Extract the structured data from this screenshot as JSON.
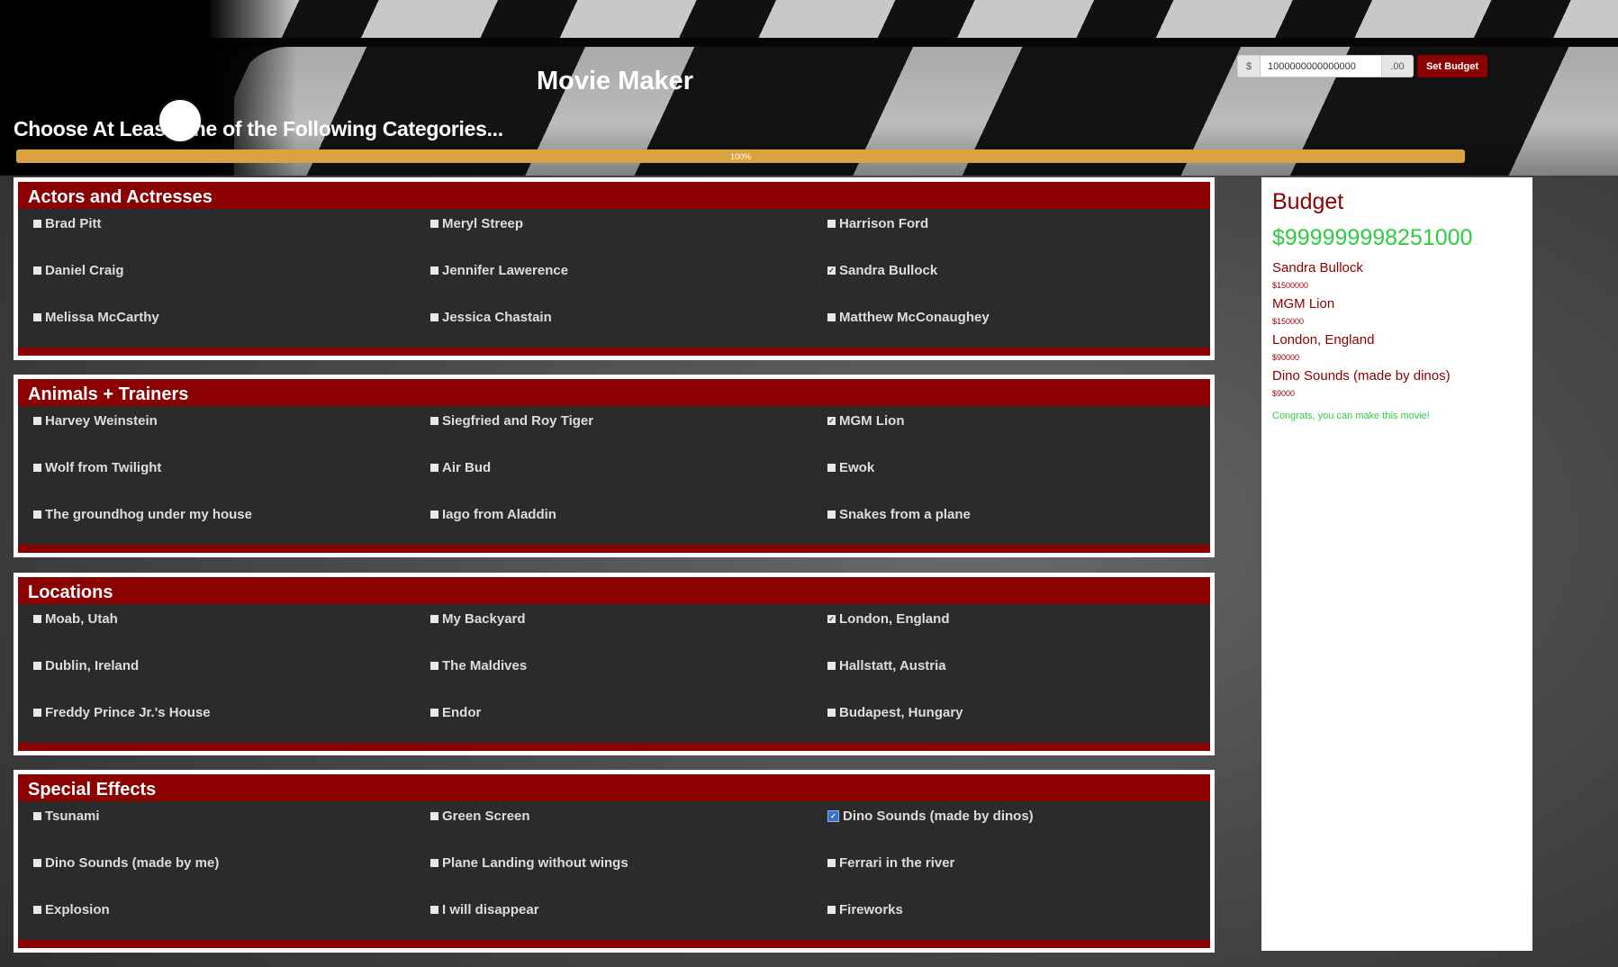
{
  "app": {
    "title": "Movie Maker",
    "subtitle": "Choose At Least One of the Following Categories..."
  },
  "budget_form": {
    "currency": "$",
    "value": "1000000000000000",
    "cents": ".00",
    "button": "Set Budget"
  },
  "progress": {
    "percent": 100,
    "label": "100%",
    "color": "#d9a440"
  },
  "colors": {
    "accent": "#8b0000",
    "success": "#2ecc40",
    "panel": "#2b2b2b"
  },
  "categories": [
    {
      "title": "Actors and Actresses",
      "options": [
        {
          "label": "Brad Pitt",
          "checked": false
        },
        {
          "label": "Meryl Streep",
          "checked": false
        },
        {
          "label": "Harrison Ford",
          "checked": false
        },
        {
          "label": "Daniel Craig",
          "checked": false
        },
        {
          "label": "Jennifer Lawerence",
          "checked": false
        },
        {
          "label": "Sandra Bullock",
          "checked": true
        },
        {
          "label": "Melissa McCarthy",
          "checked": false
        },
        {
          "label": "Jessica Chastain",
          "checked": false
        },
        {
          "label": "Matthew McConaughey",
          "checked": false
        }
      ]
    },
    {
      "title": "Animals + Trainers",
      "options": [
        {
          "label": "Harvey Weinstein",
          "checked": false
        },
        {
          "label": "Siegfried and Roy Tiger",
          "checked": false
        },
        {
          "label": "MGM Lion",
          "checked": true
        },
        {
          "label": "Wolf from Twilight",
          "checked": false
        },
        {
          "label": "Air Bud",
          "checked": false
        },
        {
          "label": "Ewok",
          "checked": false
        },
        {
          "label": "The groundhog under my house",
          "checked": false
        },
        {
          "label": "Iago from Aladdin",
          "checked": false
        },
        {
          "label": "Snakes from a plane",
          "checked": false
        }
      ]
    },
    {
      "title": "Locations",
      "options": [
        {
          "label": "Moab, Utah",
          "checked": false
        },
        {
          "label": "My Backyard",
          "checked": false
        },
        {
          "label": "London, England",
          "checked": true
        },
        {
          "label": "Dublin, Ireland",
          "checked": false
        },
        {
          "label": "The Maldives",
          "checked": false
        },
        {
          "label": "Hallstatt, Austria",
          "checked": false
        },
        {
          "label": "Freddy Prince Jr.'s House",
          "checked": false
        },
        {
          "label": "Endor",
          "checked": false
        },
        {
          "label": "Budapest, Hungary",
          "checked": false
        }
      ]
    },
    {
      "title": "Special Effects",
      "options": [
        {
          "label": "Tsunami",
          "checked": false
        },
        {
          "label": "Green Screen",
          "checked": false
        },
        {
          "label": "Dino Sounds (made by dinos)",
          "checked": true,
          "focused": true
        },
        {
          "label": "Dino Sounds (made by me)",
          "checked": false
        },
        {
          "label": "Plane Landing without wings",
          "checked": false
        },
        {
          "label": "Ferrari in the river",
          "checked": false
        },
        {
          "label": "Explosion",
          "checked": false
        },
        {
          "label": "I will disappear",
          "checked": false
        },
        {
          "label": "Fireworks",
          "checked": false
        }
      ]
    }
  ],
  "sidebar": {
    "title": "Budget",
    "total": "$999999998251000",
    "items": [
      {
        "name": "Sandra Bullock",
        "price": "$1500000"
      },
      {
        "name": "MGM Lion",
        "price": "$150000"
      },
      {
        "name": "London, England",
        "price": "$90000"
      },
      {
        "name": "Dino Sounds (made by dinos)",
        "price": "$9000"
      }
    ],
    "message": "Congrats, you can make this movie!"
  }
}
